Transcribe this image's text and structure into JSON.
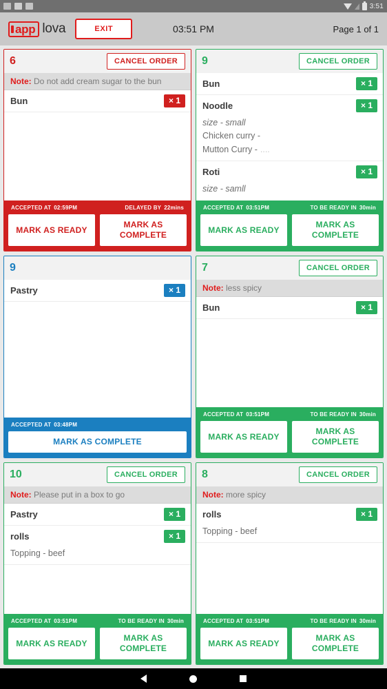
{
  "status_bar": {
    "time": "3:51",
    "icons": [
      "notification-icon",
      "notification-icon",
      "notification-icon",
      "wifi-icon",
      "signal-icon",
      "battery-icon"
    ]
  },
  "header": {
    "logo_mark": "app",
    "logo_word": "lova",
    "exit_label": "EXIT",
    "clock": "03:51 PM",
    "page_info": "Page 1 of 1"
  },
  "colors": {
    "red": "#d0201f",
    "green": "#2aae5f",
    "blue": "#1b7fc0",
    "note_bg": "#dcdcdc",
    "header_bg": "#c9c9c9"
  },
  "labels": {
    "cancel_order": "CANCEL ORDER",
    "note_prefix": "Note:",
    "accepted_at": "ACCEPTED AT",
    "delayed_by": "DELAYED BY",
    "to_be_ready_in": "TO BE READY IN",
    "mark_as_ready": "MARK AS READY",
    "mark_as_complete": "MARK AS COMPLETE"
  },
  "orders": [
    {
      "number": "6",
      "theme": "red",
      "has_cancel": true,
      "note": "Do not add cream sugar to the bun",
      "items": [
        {
          "name": "Bun",
          "qty": "× 1",
          "options": []
        }
      ],
      "accepted_at": "02:59PM",
      "timer_label": "DELAYED BY",
      "timer_value": "22mins",
      "actions": [
        "MARK AS READY",
        "MARK AS COMPLETE"
      ]
    },
    {
      "number": "9",
      "theme": "green",
      "has_cancel": true,
      "note": null,
      "items": [
        {
          "name": "Bun",
          "qty": "× 1",
          "options": []
        },
        {
          "name": "Noodle",
          "qty": "× 1",
          "options": [
            {
              "text": "size - small",
              "style": "italic"
            },
            {
              "text": "Chicken curry -",
              "style": "normal"
            },
            {
              "text": "Mutton Curry -",
              "style": "normal",
              "trailing": "....",
              "trailing_style": "faded"
            }
          ]
        },
        {
          "name": "Roti",
          "qty": "× 1",
          "options": [
            {
              "text": "size - samll",
              "style": "italic"
            }
          ]
        }
      ],
      "accepted_at": "03:51PM",
      "timer_label": "TO BE READY IN",
      "timer_value": "30min",
      "actions": [
        "MARK AS READY",
        "MARK AS COMPLETE"
      ]
    },
    {
      "number": "9",
      "theme": "blue",
      "has_cancel": false,
      "note": null,
      "items": [
        {
          "name": "Pastry",
          "qty": "× 1",
          "options": []
        }
      ],
      "accepted_at": "03:48PM",
      "timer_label": null,
      "timer_value": null,
      "actions": [
        "MARK AS COMPLETE"
      ]
    },
    {
      "number": "7",
      "theme": "green",
      "has_cancel": true,
      "note": "less spicy",
      "items": [
        {
          "name": "Bun",
          "qty": "× 1",
          "options": []
        }
      ],
      "accepted_at": "03:51PM",
      "timer_label": "TO BE READY IN",
      "timer_value": "30min",
      "actions": [
        "MARK AS READY",
        "MARK AS COMPLETE"
      ]
    },
    {
      "number": "10",
      "theme": "green",
      "has_cancel": true,
      "note": "Please put in a box to go",
      "items": [
        {
          "name": "Pastry",
          "qty": "× 1",
          "options": []
        },
        {
          "name": "rolls",
          "qty": "× 1",
          "options": [
            {
              "text": "Topping - beef",
              "style": "normal"
            }
          ]
        }
      ],
      "accepted_at": "03:51PM",
      "timer_label": "TO BE READY IN",
      "timer_value": "30min",
      "actions": [
        "MARK AS READY",
        "MARK AS COMPLETE"
      ]
    },
    {
      "number": "8",
      "theme": "green",
      "has_cancel": true,
      "note": "more spicy",
      "items": [
        {
          "name": "rolls",
          "qty": "× 1",
          "options": [
            {
              "text": "Topping - beef",
              "style": "normal"
            }
          ]
        }
      ],
      "accepted_at": "03:51PM",
      "timer_label": "TO BE READY IN",
      "timer_value": "30min",
      "actions": [
        "MARK AS READY",
        "MARK AS COMPLETE"
      ]
    }
  ],
  "nav_bar": {
    "items": [
      "back-icon",
      "home-icon",
      "recents-icon"
    ]
  }
}
